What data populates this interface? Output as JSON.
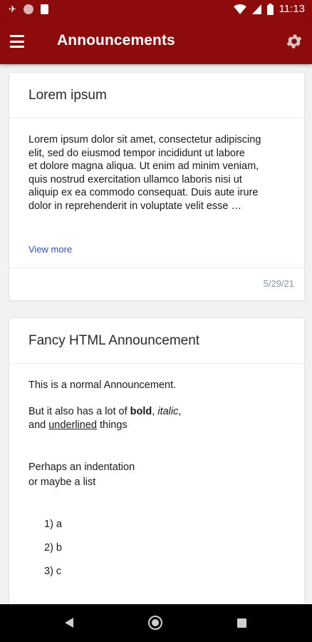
{
  "status_bar": {
    "time": "11:13"
  },
  "app_bar": {
    "title": "Announcements",
    "menu_icon": "hamburger-menu-icon",
    "settings_icon": "gear-icon"
  },
  "colors": {
    "primary": "#8e0b0b",
    "link": "#2d4fd6",
    "date": "#8a96a6"
  },
  "announcements": [
    {
      "title": "Lorem ipsum",
      "lines": [
        "Lorem ipsum dolor sit amet, consectetur adipiscing",
        "elit, sed do eiusmod tempor incididunt ut labore",
        "et dolore magna aliqua. Ut enim ad minim veniam,",
        "quis nostrud exercitation ullamco laboris nisi ut",
        "aliquip ex ea commodo consequat. Duis aute irure",
        "dolor in reprehenderit in voluptate velit esse …"
      ],
      "view_more": "View more",
      "date": "5/29/21"
    },
    {
      "title": "Fancy HTML Announcement",
      "p1": "This is a normal Announcement.",
      "p2_prefix": "But it also has a lot of ",
      "p2_bold": "bold",
      "p2_comma": ", ",
      "p2_italic": "italic",
      "p2_end": ",",
      "p3_prefix": "and ",
      "p3_underlined": "underlined",
      "p3_end": " things",
      "p4_line1": "Perhaps an indentation",
      "p4_line2": "or maybe a list",
      "list": [
        "1)  a",
        "2)  b",
        "3)  c"
      ]
    }
  ]
}
